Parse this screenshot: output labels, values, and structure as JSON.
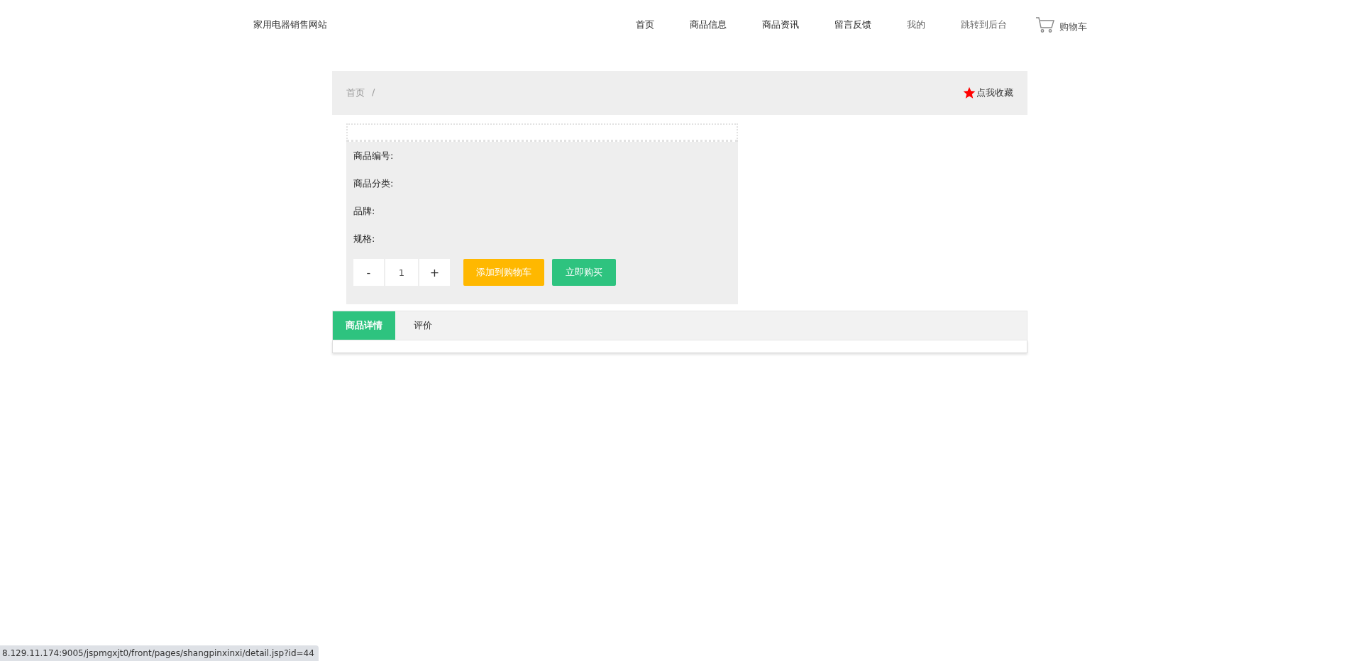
{
  "header": {
    "site_title": "家用电器销售网站",
    "nav": [
      {
        "label": "首页",
        "kind": "primary"
      },
      {
        "label": "商品信息",
        "kind": "primary"
      },
      {
        "label": "商品资讯",
        "kind": "primary"
      },
      {
        "label": "留言反馈",
        "kind": "primary"
      },
      {
        "label": "我的",
        "kind": "secondary"
      },
      {
        "label": "跳转到后台",
        "kind": "secondary"
      }
    ],
    "cart": {
      "label": "购物车"
    }
  },
  "breadcrumb": {
    "items": [
      "首页"
    ],
    "separator": "/",
    "favorite": "点我收藏"
  },
  "product": {
    "fields": [
      "商品编号:",
      "商品分类:",
      "品牌:",
      "规格:"
    ],
    "quantity": {
      "minus": "-",
      "value": "1",
      "plus": "+"
    },
    "buttons": [
      {
        "label": "添加到购物车",
        "kind": "cart"
      },
      {
        "label": "立即购买",
        "kind": "buy"
      }
    ]
  },
  "tabs": [
    {
      "label": "商品详情",
      "selected": true
    },
    {
      "label": "评价",
      "selected": false
    }
  ],
  "status_bar": {
    "url": "8.129.11.174:9005/jspmgxjt0/front/pages/shangpinxinxi/detail.jsp?id=44"
  }
}
